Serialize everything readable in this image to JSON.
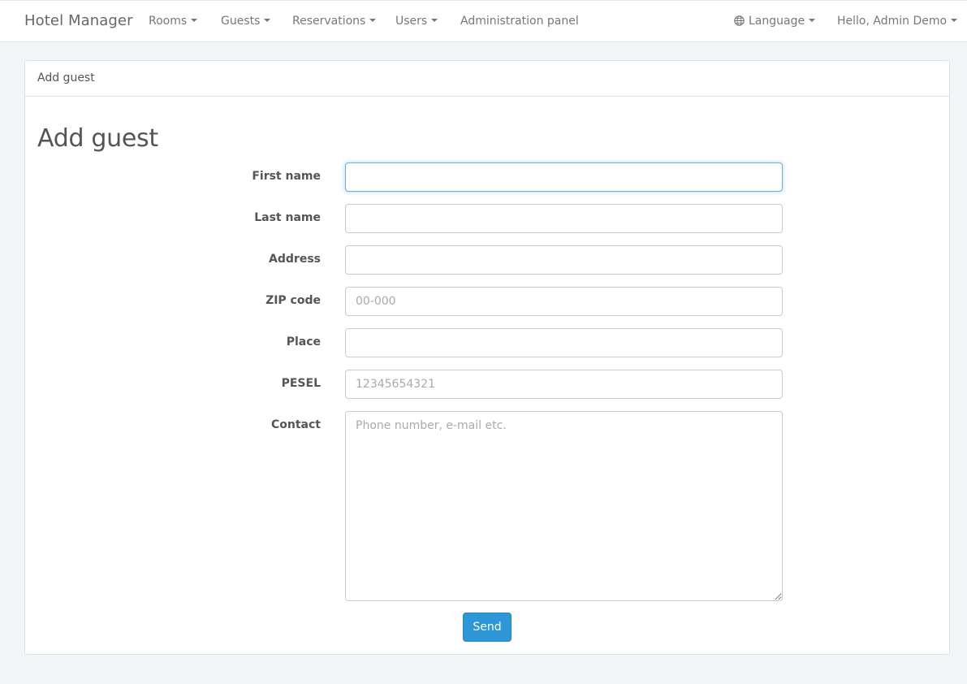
{
  "navbar": {
    "brand": "Hotel Manager",
    "items": [
      {
        "label": "Rooms"
      },
      {
        "label": "Guests"
      },
      {
        "label": "Reservations"
      },
      {
        "label": "Users"
      },
      {
        "label": "Administration panel"
      }
    ],
    "language": {
      "label": "Language",
      "icon": "globe-icon"
    },
    "user": {
      "label": "Hello, Admin Demo"
    }
  },
  "panel": {
    "heading": "Add guest",
    "title": "Add guest"
  },
  "form": {
    "first_name": {
      "label": "First name",
      "value": "",
      "placeholder": ""
    },
    "last_name": {
      "label": "Last name",
      "value": "",
      "placeholder": ""
    },
    "address": {
      "label": "Address",
      "value": "",
      "placeholder": ""
    },
    "zip_code": {
      "label": "ZIP code",
      "value": "",
      "placeholder": "00-000"
    },
    "place": {
      "label": "Place",
      "value": "",
      "placeholder": ""
    },
    "pesel": {
      "label": "PESEL",
      "value": "",
      "placeholder": "12345654321"
    },
    "contact": {
      "label": "Contact",
      "value": "",
      "placeholder": "Phone number, e-mail etc."
    },
    "submit_label": "Send"
  },
  "colors": {
    "primary": "#2e97d8",
    "background": "#f3f6f9",
    "focus_border": "#66afe9"
  }
}
